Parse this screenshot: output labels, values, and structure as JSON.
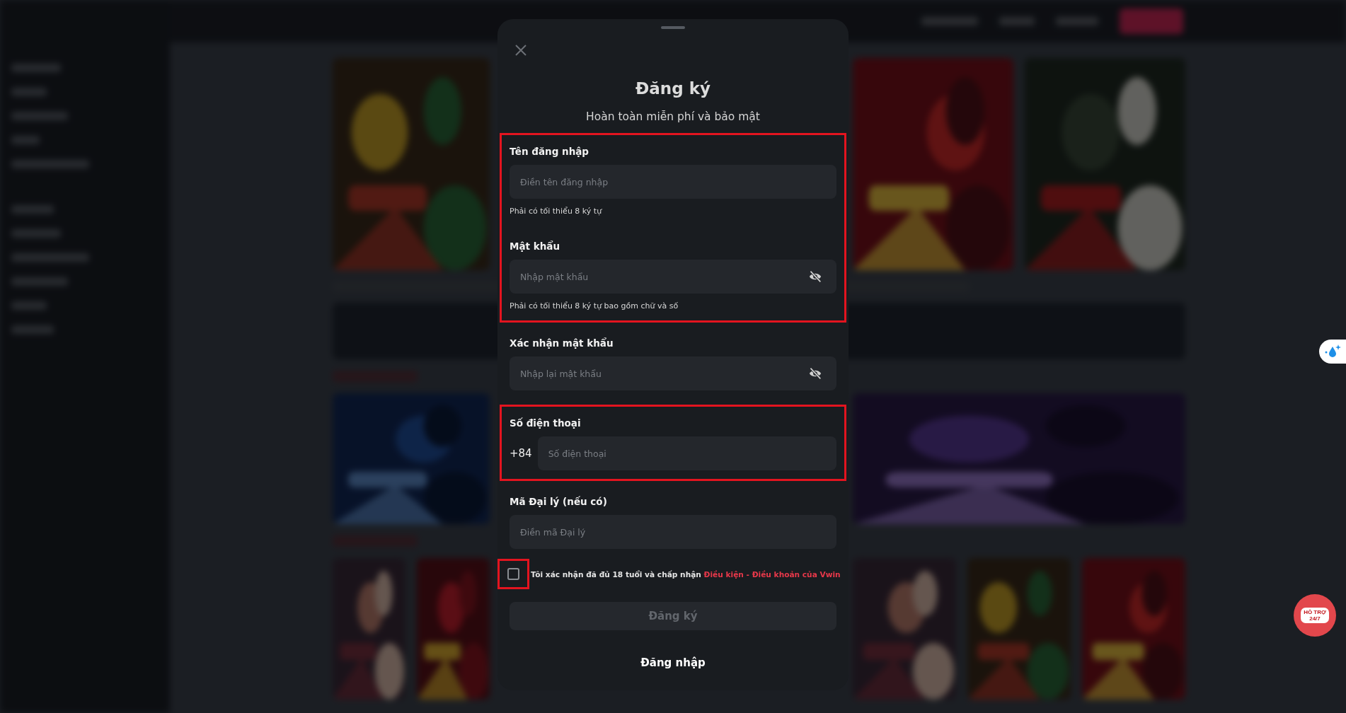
{
  "dialog": {
    "title": "Đăng ký",
    "subtitle": "Hoàn toàn miễn phí và bảo mật",
    "sections": [
      {
        "highlighted": true,
        "fields": [
          {
            "kind": "text",
            "label": "Tên đăng nhập",
            "placeholder": "Điền tên đăng nhập",
            "hint": "Phải có tối thiểu 8 ký tự"
          },
          {
            "kind": "password",
            "label": "Mật khẩu",
            "placeholder": "Nhập mật khẩu",
            "hint": "Phải có tối thiểu 8 ký tự bao gồm chữ và số",
            "hidden": true
          }
        ]
      },
      {
        "highlighted": false,
        "fields": [
          {
            "kind": "password",
            "label": "Xác nhận mật khẩu",
            "placeholder": "Nhập lại mật khẩu",
            "hidden": true
          }
        ]
      },
      {
        "highlighted": true,
        "fields": [
          {
            "kind": "phone",
            "label": "Số điện thoại",
            "prefix": "+84",
            "placeholder": "Số điện thoại"
          }
        ]
      },
      {
        "highlighted": false,
        "fields": [
          {
            "kind": "text",
            "label": "Mã Đại lý (nếu có)",
            "placeholder": "Điền mã Đại lý"
          }
        ]
      }
    ],
    "agreement": {
      "checked": false,
      "highlighted": true,
      "text": "Tôi xác nhận đã đủ 18 tuổi và chấp nhận",
      "link": "Điều kiện - Điều khoản của Vwin"
    },
    "submit": {
      "label": "Đăng ký",
      "disabled": true
    },
    "login_link": "Đăng nhập"
  },
  "support_badge": {
    "line1": "HỖ TRỢ",
    "line2": "24/7"
  }
}
